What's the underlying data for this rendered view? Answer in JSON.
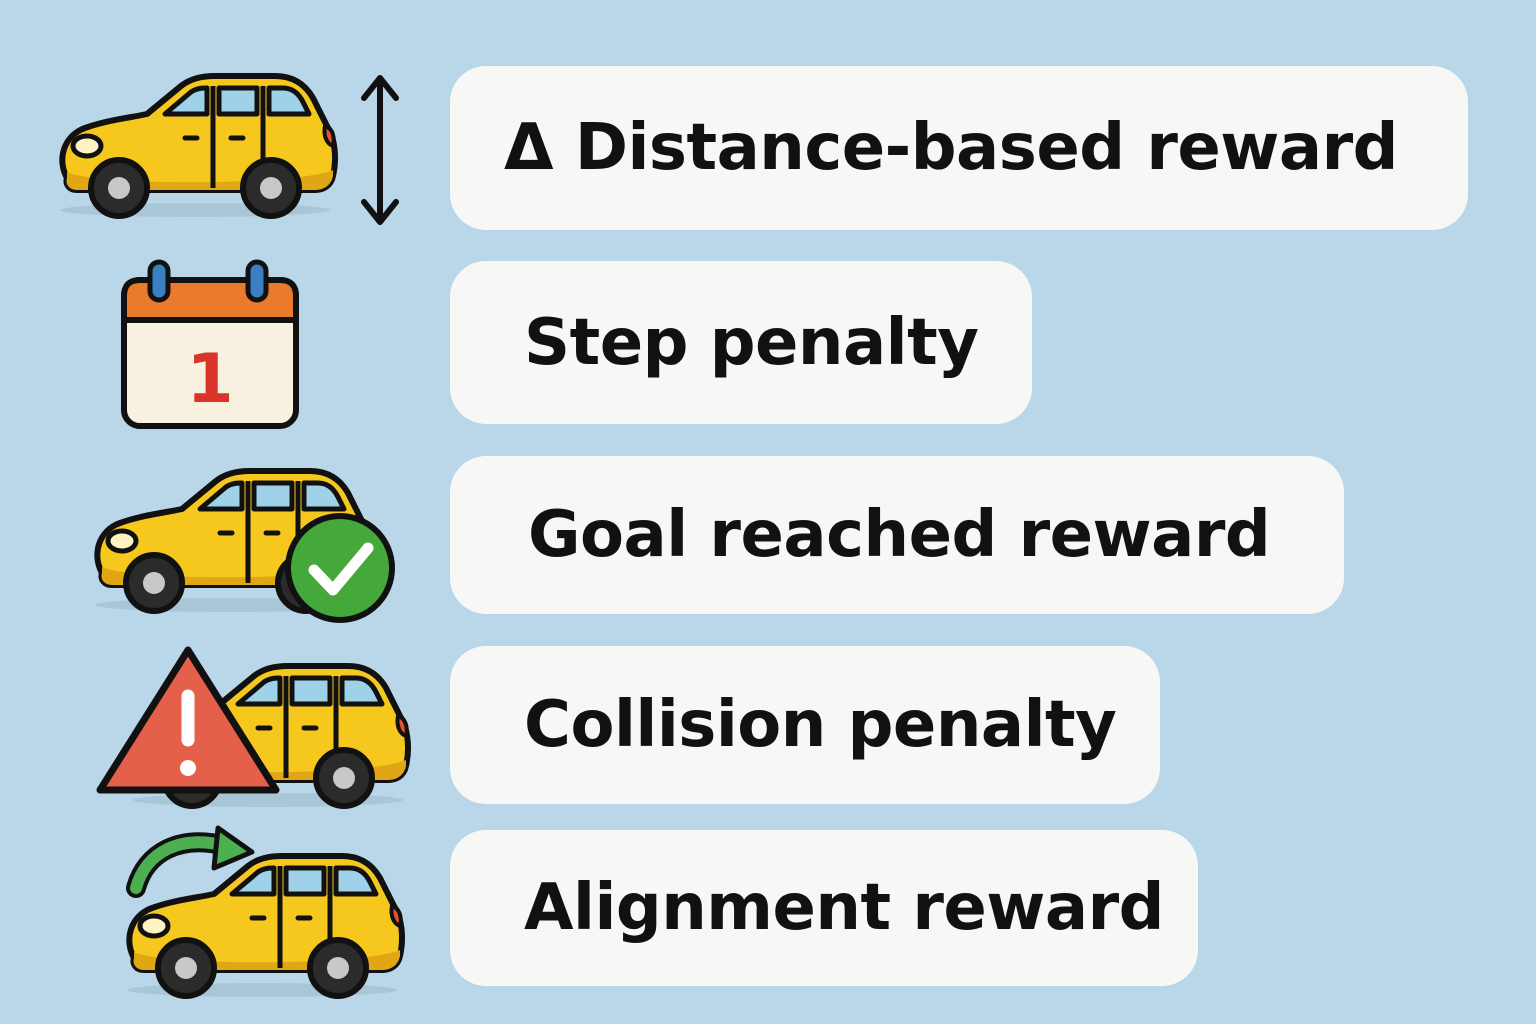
{
  "rows": [
    {
      "label": "Δ Distance-based reward",
      "icon": "car-with-vertical-arrow-icon"
    },
    {
      "label": "Step penalty",
      "icon": "calendar-icon",
      "calendar_number": "1"
    },
    {
      "label": "Goal reached reward",
      "icon": "car-with-checkmark-icon"
    },
    {
      "label": "Collision penalty",
      "icon": "car-with-warning-icon"
    },
    {
      "label": "Alignment reward",
      "icon": "car-with-curved-arrow-icon"
    }
  ],
  "colors": {
    "background": "#b9d7e9",
    "card": "#f7f7f6",
    "car_body": "#f6c81e",
    "calendar_header": "#ea7a2c",
    "calendar_number": "#d8342a",
    "check_green": "#45a83a",
    "warning_red": "#e5604a",
    "arrow_green": "#4caf50"
  }
}
